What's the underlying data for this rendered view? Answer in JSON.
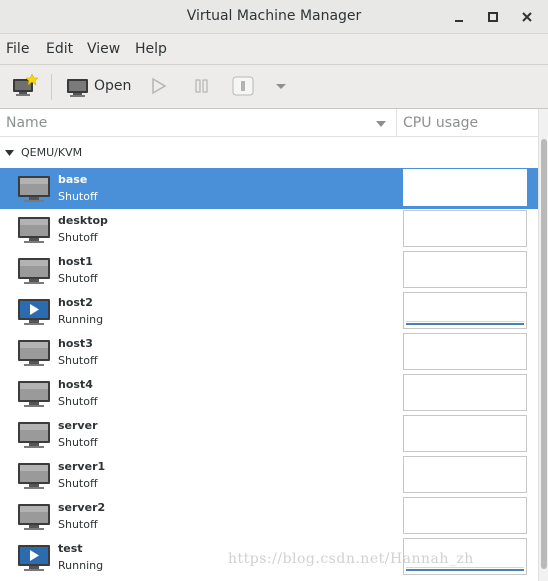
{
  "window": {
    "title": "Virtual Machine Manager"
  },
  "menubar": {
    "items": [
      "File",
      "Edit",
      "View",
      "Help"
    ]
  },
  "toolbar": {
    "open_label": "Open"
  },
  "columns": {
    "name": "Name",
    "cpu": "CPU usage"
  },
  "group": {
    "label": "QEMU/KVM"
  },
  "vms": [
    {
      "name": "base",
      "state": "Shutoff"
    },
    {
      "name": "desktop",
      "state": "Shutoff"
    },
    {
      "name": "host1",
      "state": "Shutoff"
    },
    {
      "name": "host2",
      "state": "Running"
    },
    {
      "name": "host3",
      "state": "Shutoff"
    },
    {
      "name": "host4",
      "state": "Shutoff"
    },
    {
      "name": "server",
      "state": "Shutoff"
    },
    {
      "name": "server1",
      "state": "Shutoff"
    },
    {
      "name": "server2",
      "state": "Shutoff"
    },
    {
      "name": "test",
      "state": "Running"
    }
  ],
  "selected_vm": "base",
  "watermark": "https://blog.csdn.net/Hannah_zh",
  "colors": {
    "selection": "#4a90d9",
    "cpu_graph": "#4a7fb0"
  },
  "icons": {
    "running": "monitor-play-icon",
    "shutoff": "monitor-off-icon"
  }
}
